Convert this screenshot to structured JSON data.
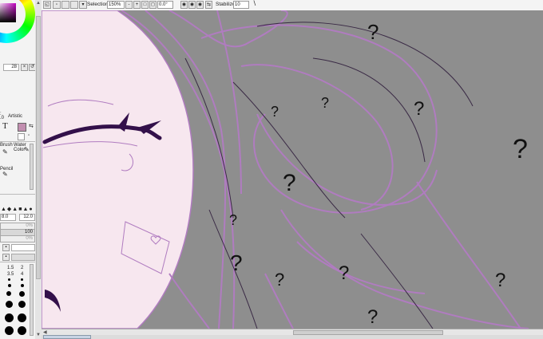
{
  "toolbar": {
    "selection_label": "Selection",
    "zoom": "150%",
    "zoom_minus": "-",
    "zoom_plus": "+",
    "rotation": "0.0°",
    "stabilizer_label": "Stabilizer",
    "stabilizer_value": "10"
  },
  "left_panel": {
    "brush_size_value": "28",
    "tool_t_glyph": "T",
    "tool_labels": {
      "artistic": "Artistic",
      "brush": "Brush",
      "water_color": "Water Color",
      "pencil": "Pencil"
    },
    "size_value": "8.0",
    "size_max": "12.0",
    "density_value": "100",
    "min_size_value": "0%",
    "min_density_value": "0%",
    "brush_size_presets": [
      "1.5",
      "2",
      "3.5",
      "4",
      "5",
      "6",
      "8",
      "10",
      "16",
      "20",
      "25",
      "30",
      "40",
      "50"
    ]
  },
  "canvas": {
    "annotation_mark": "?",
    "colors": {
      "background": "#8e8e8e",
      "skin": "#f7e7ef",
      "hair_line": "#b07cc0",
      "dark_line": "#3a2a45",
      "eye": "#33104a"
    }
  }
}
